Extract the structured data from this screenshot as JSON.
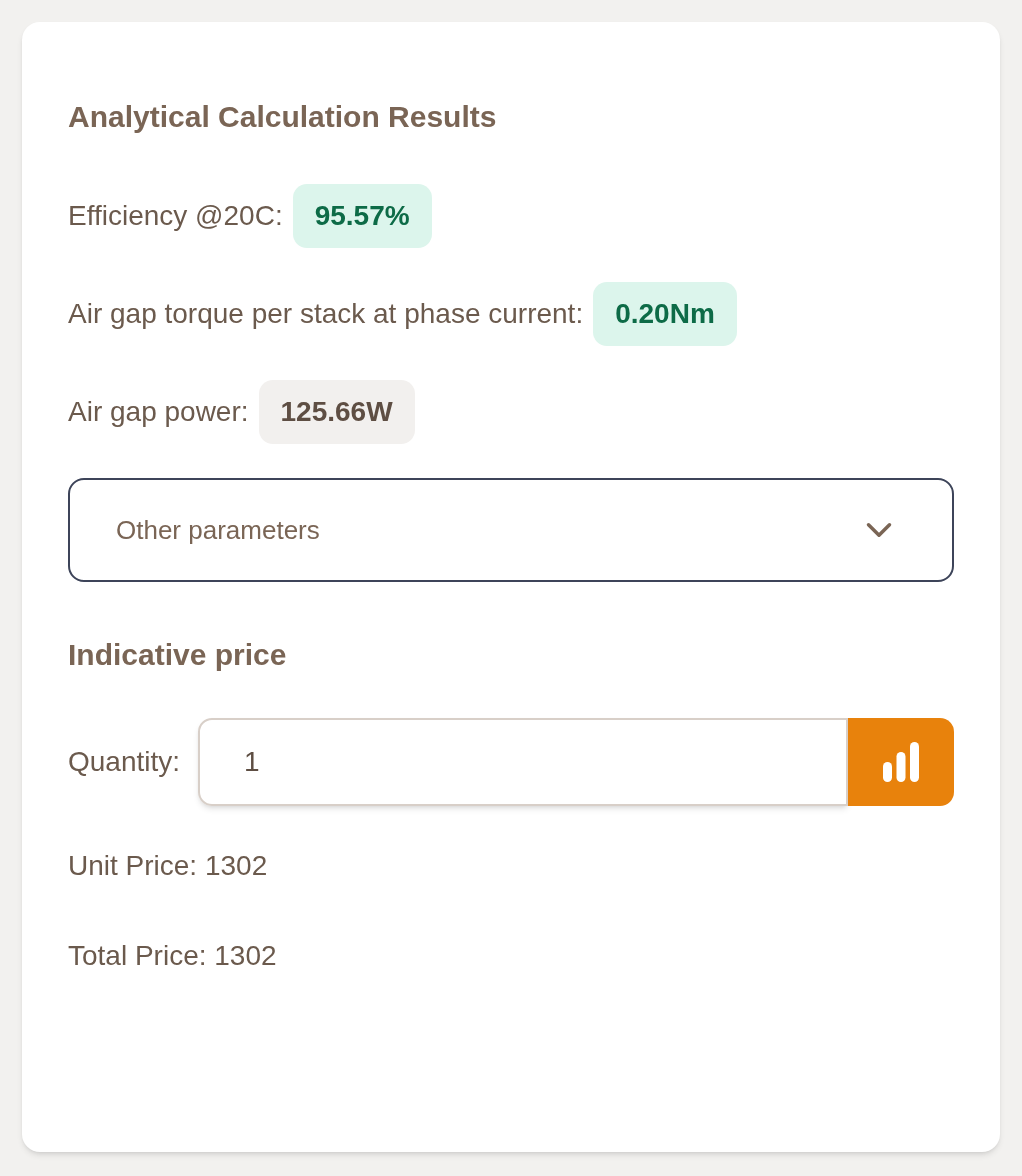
{
  "results": {
    "title": "Analytical Calculation Results",
    "metrics": [
      {
        "label": "Efficiency @20C:",
        "value": "95.57%",
        "kind": "positive"
      },
      {
        "label": "Air gap torque per stack at phase current:",
        "value": "0.20Nm",
        "kind": "positive"
      },
      {
        "label": "Air gap power:",
        "value": "125.66W",
        "kind": "neutral"
      }
    ],
    "dropdown": {
      "label": "Other parameters",
      "expanded": false
    }
  },
  "price": {
    "title": "Indicative price",
    "quantity_label": "Quantity:",
    "quantity_value": "1",
    "lines": [
      "Unit Price: 1302",
      "Total Price: 1302"
    ]
  }
}
